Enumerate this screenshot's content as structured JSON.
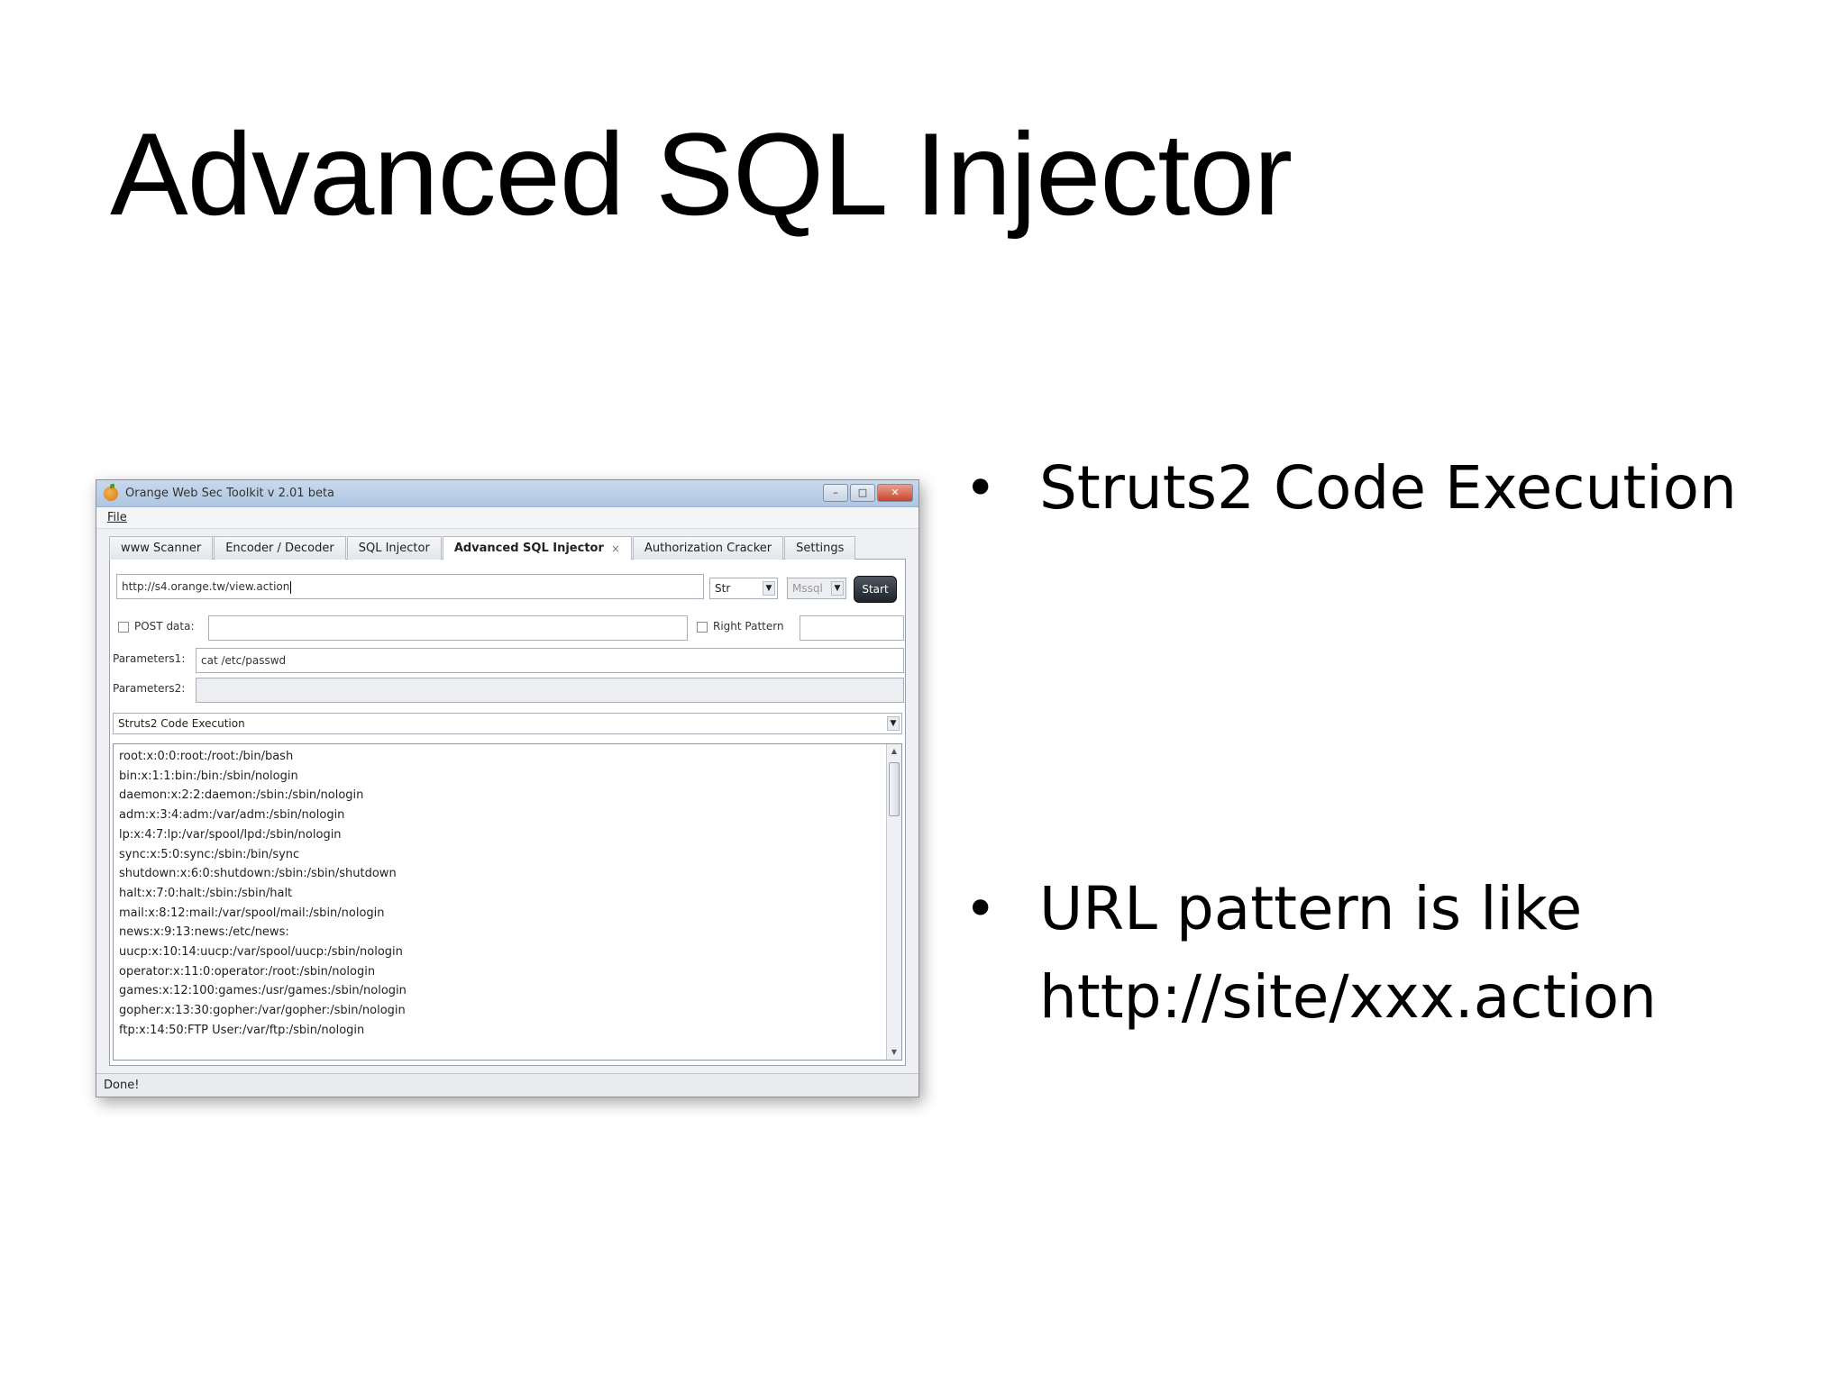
{
  "slide": {
    "title": "Advanced SQL Injector",
    "bullets": [
      {
        "lines": [
          "Struts2 Code Execution"
        ]
      },
      {
        "lines": [
          "URL pattern is like",
          "http://site/xxx.action"
        ]
      }
    ]
  },
  "window": {
    "title": "Orange Web Sec Toolkit v 2.01 beta",
    "controls": {
      "minimize": "–",
      "maximize": "□",
      "close": "✕"
    },
    "menu": [
      "File"
    ],
    "tabs": [
      {
        "label": "www Scanner",
        "active": false
      },
      {
        "label": "Encoder / Decoder",
        "active": false
      },
      {
        "label": "SQL Injector",
        "active": false
      },
      {
        "label": "Advanced SQL Injector",
        "active": true,
        "close": "×"
      },
      {
        "label": "Authorization Cracker",
        "active": false
      },
      {
        "label": "Settings",
        "active": false
      }
    ],
    "form": {
      "url_value": "http://s4.orange.tw/view.action",
      "type_select": "Str",
      "method_select": "Mssql",
      "start_label": "Start",
      "post_data_label": "POST data:",
      "post_data_value": "",
      "right_pattern_label": "Right Pattern",
      "right_pattern_value": "",
      "parameters1_label": "Parameters1:",
      "parameters1_value": "cat /etc/passwd",
      "parameters2_label": "Parameters2:",
      "parameters2_value": "",
      "mode_select": "Struts2 Code Execution"
    },
    "output_lines": [
      "root:x:0:0:root:/root:/bin/bash",
      "bin:x:1:1:bin:/bin:/sbin/nologin",
      "daemon:x:2:2:daemon:/sbin:/sbin/nologin",
      "adm:x:3:4:adm:/var/adm:/sbin/nologin",
      "lp:x:4:7:lp:/var/spool/lpd:/sbin/nologin",
      "sync:x:5:0:sync:/sbin:/bin/sync",
      "shutdown:x:6:0:shutdown:/sbin:/sbin/shutdown",
      "halt:x:7:0:halt:/sbin:/sbin/halt",
      "mail:x:8:12:mail:/var/spool/mail:/sbin/nologin",
      "news:x:9:13:news:/etc/news:",
      "uucp:x:10:14:uucp:/var/spool/uucp:/sbin/nologin",
      "operator:x:11:0:operator:/root:/sbin/nologin",
      "games:x:12:100:games:/usr/games:/sbin/nologin",
      "gopher:x:13:30:gopher:/var/gopher:/sbin/nologin",
      "ftp:x:14:50:FTP User:/var/ftp:/sbin/nologin"
    ],
    "status": "Done!"
  }
}
